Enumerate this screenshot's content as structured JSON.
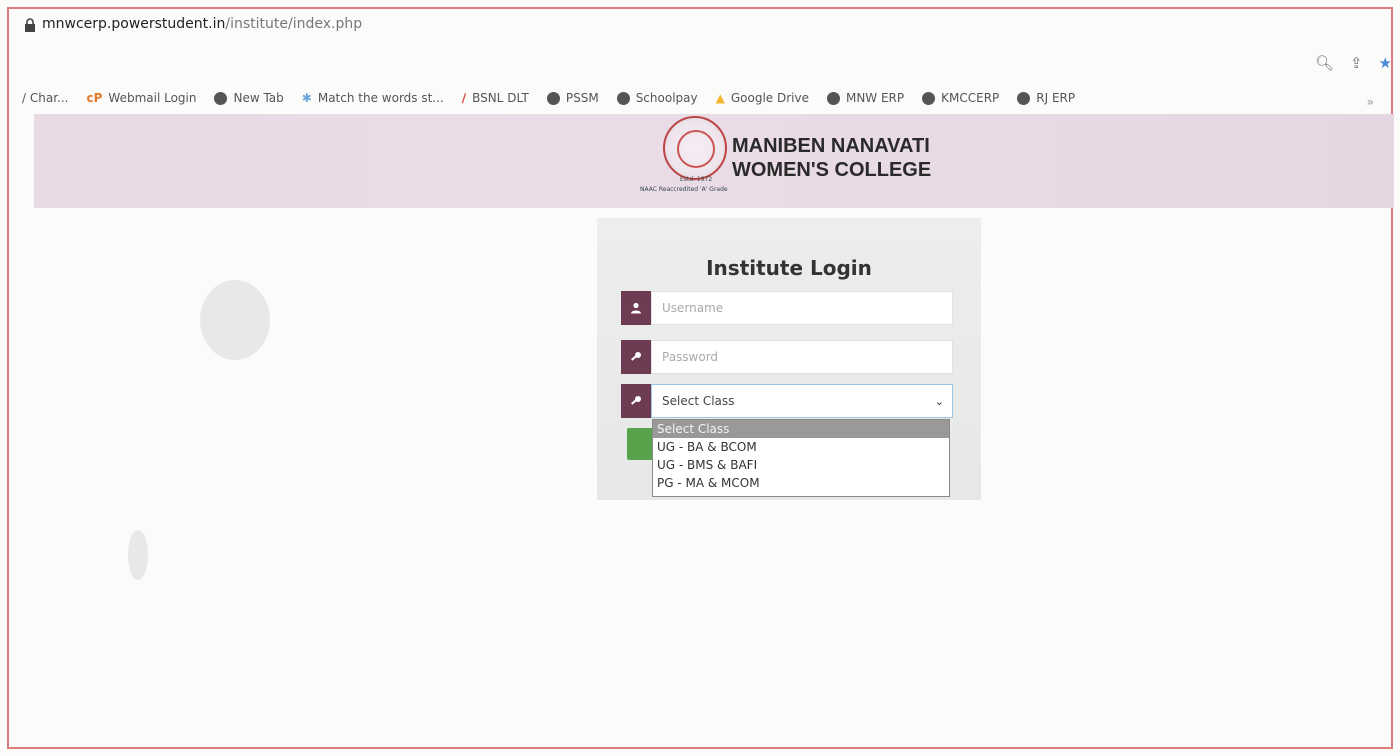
{
  "browser": {
    "url_main": "mnwcerp.powerstudent.in",
    "url_path": "/institute/index.php"
  },
  "bookmarks": [
    {
      "label": "/ Char...",
      "icon": "text"
    },
    {
      "label": "Webmail Login",
      "icon": "cp-icon"
    },
    {
      "label": "New Tab",
      "icon": "globe-icon"
    },
    {
      "label": "Match the words st...",
      "icon": "match-icon"
    },
    {
      "label": "BSNL DLT",
      "icon": "bsnl-icon"
    },
    {
      "label": "PSSM",
      "icon": "globe-icon"
    },
    {
      "label": "Schoolpay",
      "icon": "globe-icon"
    },
    {
      "label": "Google Drive",
      "icon": "drive-icon"
    },
    {
      "label": "MNW ERP",
      "icon": "globe-icon"
    },
    {
      "label": "KMCCERP",
      "icon": "globe-icon"
    },
    {
      "label": "RJ ERP",
      "icon": "globe-icon"
    }
  ],
  "bookmarks_more": "»",
  "header": {
    "college_line1": "MANIBEN NANAVATI",
    "college_line2": "WOMEN'S COLLEGE",
    "logo_est": "Estd. 1972",
    "logo_naac": "NAAC Reaccredited 'A' Grade"
  },
  "login": {
    "title": "Institute Login",
    "username_placeholder": "Username",
    "password_placeholder": "Password",
    "class_select_value": "Select Class",
    "class_options": [
      {
        "label": "Select Class",
        "selected": true
      },
      {
        "label": "UG - BA & BCOM",
        "selected": false
      },
      {
        "label": "UG - BMS & BAFI",
        "selected": false
      },
      {
        "label": "PG - MA & MCOM",
        "selected": false
      }
    ]
  },
  "colors": {
    "icon_box": "#6d3b52",
    "header_band": "#e8dbe4",
    "submit_button": "#58a24b"
  }
}
